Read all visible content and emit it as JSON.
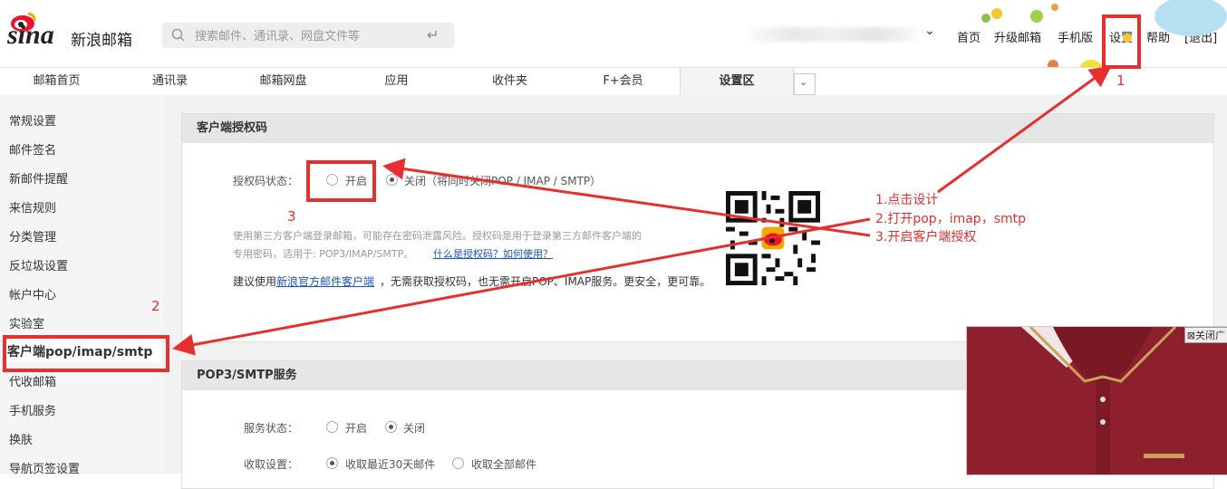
{
  "header": {
    "logo": "sina",
    "brand": "新浪邮箱",
    "search_placeholder": "搜索邮件、通讯录、网盘文件等",
    "user_caret": "⌄",
    "links": [
      "首页",
      "升级邮箱",
      "手机版",
      "设置",
      "帮助",
      "[退出]"
    ]
  },
  "tabs": [
    "邮箱首页",
    "通讯录",
    "邮箱网盘",
    "应用",
    "收件夹",
    "F+会员",
    "设置区"
  ],
  "active_tab": "设置区",
  "sidebar": {
    "items": [
      "常规设置",
      "邮件签名",
      "新邮件提醒",
      "来信规则",
      "分类管理",
      "反垃圾设置",
      "帐户中心",
      "实验室",
      "客户端pop/imap/smtp",
      "代收邮箱",
      "手机服务",
      "换肤",
      "导航页签设置"
    ],
    "active": "客户端pop/imap/smtp"
  },
  "auth_panel": {
    "title": "客户端授权码",
    "status_label": "授权码状态：",
    "option_on": "开启",
    "option_off": "关闭（将同时关闭POP / IMAP / SMTP）",
    "selected": "关闭",
    "desc_line1": "使用第三方客户端登录邮箱，可能存在密码泄露风险。授权码是用于登录第三方邮件客户端的",
    "desc_line2": "专用密码，适用于: POP3/IMAP/SMTP。",
    "desc_link": "什么是授权码？如何使用？",
    "suggest_prefix": "建议使用",
    "suggest_link": "新浪官方邮件客户端",
    "suggest_suffix": "，无需获取授权码，也无需开启POP、IMAP服务。更安全，更可靠。"
  },
  "pop_panel": {
    "title": "POP3/SMTP服务",
    "service_label": "服务状态：",
    "service_on": "开启",
    "service_off": "关闭",
    "service_selected": "关闭",
    "fetch_label": "收取设置：",
    "fetch_30": "收取最近30天邮件",
    "fetch_all": "收取全部邮件",
    "fetch_selected": "收取最近30天邮件"
  },
  "annotations": {
    "num1": "1",
    "num2": "2",
    "num3": "3",
    "steps": [
      "1.点击设计",
      "2.打开pop，imap，smtp",
      "3.开启客户端授权"
    ],
    "color": "#e63030"
  },
  "ad": {
    "close_label": "关闭广"
  }
}
